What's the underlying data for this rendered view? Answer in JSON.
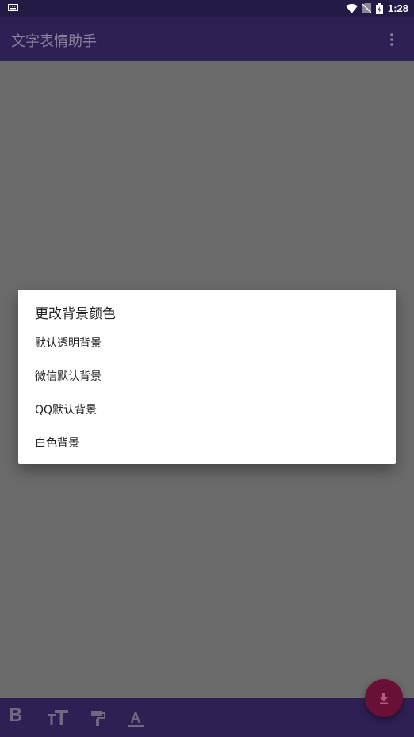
{
  "status_bar": {
    "time": "1:28"
  },
  "app_bar": {
    "title": "文字表情助手"
  },
  "dialog": {
    "title": "更改背景颜色",
    "options": [
      {
        "label": "默认透明背景"
      },
      {
        "label": "微信默认背景"
      },
      {
        "label": "QQ默认背景"
      },
      {
        "label": "白色背景"
      }
    ]
  },
  "bottom_toolbar": {
    "bold_label": "B",
    "icons": [
      "bold-icon",
      "text-size-icon",
      "paint-roller-icon",
      "text-color-icon"
    ]
  },
  "fab": {
    "icon": "download-icon"
  },
  "colors": {
    "app_bar": "#2e1f54",
    "status_bar": "#251a45",
    "scrim": "#6b6b6b",
    "fab": "#6a1037",
    "dialog_bg": "#ffffff"
  }
}
